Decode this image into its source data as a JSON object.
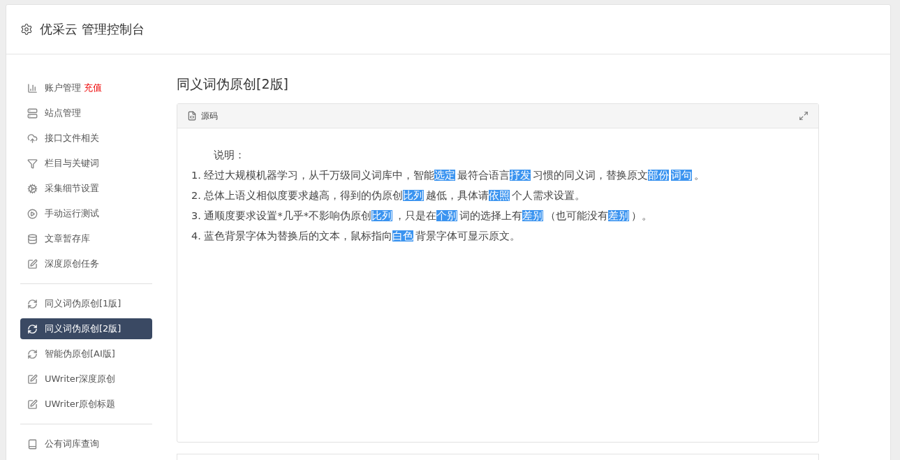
{
  "header": {
    "title": "优采云 管理控制台"
  },
  "sidebar": {
    "groups": [
      {
        "items": [
          {
            "label": "账户管理",
            "badge": "充值",
            "selected": false
          },
          {
            "label": "站点管理",
            "selected": false
          },
          {
            "label": "接口文件相关",
            "selected": false
          },
          {
            "label": "栏目与关键词",
            "selected": false
          },
          {
            "label": "采集细节设置",
            "selected": false
          },
          {
            "label": "手动运行测试",
            "selected": false
          },
          {
            "label": "文章暂存库",
            "selected": false
          },
          {
            "label": "深度原创任务",
            "selected": false
          }
        ]
      },
      {
        "items": [
          {
            "label": "同义词伪原创[1版]",
            "selected": false
          },
          {
            "label": "同义词伪原创[2版]",
            "selected": true
          },
          {
            "label": "智能伪原创[AI版]",
            "selected": false
          },
          {
            "label": "UWriter深度原创",
            "selected": false
          },
          {
            "label": "UWriter原创标题",
            "selected": false
          }
        ]
      },
      {
        "items": [
          {
            "label": "公有词库查询",
            "selected": false
          }
        ]
      }
    ]
  },
  "main": {
    "title": "同义词伪原创[2版]",
    "panel": {
      "tab": "源码",
      "intro": "说明：",
      "lines": [
        [
          {
            "text": "1. 经过大规模机器学习，从千万级同义词库中，智能",
            "highlighted": false
          },
          {
            "text": "选定",
            "highlighted": true
          },
          {
            "text": "最符合语言",
            "highlighted": false
          },
          {
            "text": "抒发",
            "highlighted": true
          },
          {
            "text": "习惯的同义词，替换原文",
            "highlighted": false
          },
          {
            "text": "部份",
            "highlighted": true
          },
          {
            "text": "词句",
            "highlighted": true
          },
          {
            "text": "。",
            "highlighted": false
          }
        ],
        [
          {
            "text": "2. 总体上语义相似度要求越高，得到的伪原创",
            "highlighted": false
          },
          {
            "text": "比列",
            "highlighted": true
          },
          {
            "text": "越低，具体请",
            "highlighted": false
          },
          {
            "text": "依照",
            "highlighted": true
          },
          {
            "text": "个人需求设置。",
            "highlighted": false
          }
        ],
        [
          {
            "text": "3. 通顺度要求设置*几乎*不影响伪原创",
            "highlighted": false
          },
          {
            "text": "比列",
            "highlighted": true
          },
          {
            "text": "，只是在",
            "highlighted": false
          },
          {
            "text": "个别",
            "highlighted": true
          },
          {
            "text": "词的选择上有",
            "highlighted": false
          },
          {
            "text": "差别",
            "highlighted": true
          },
          {
            "text": "（也可能没有",
            "highlighted": false
          },
          {
            "text": "差别",
            "highlighted": true
          },
          {
            "text": "）。",
            "highlighted": false
          }
        ],
        [
          {
            "text": "4. 蓝色背景字体为替换后的文本，鼠标指向",
            "highlighted": false
          },
          {
            "text": "白色",
            "highlighted": true
          },
          {
            "text": "背景字体可显示原文。",
            "highlighted": false
          }
        ]
      ]
    }
  }
}
